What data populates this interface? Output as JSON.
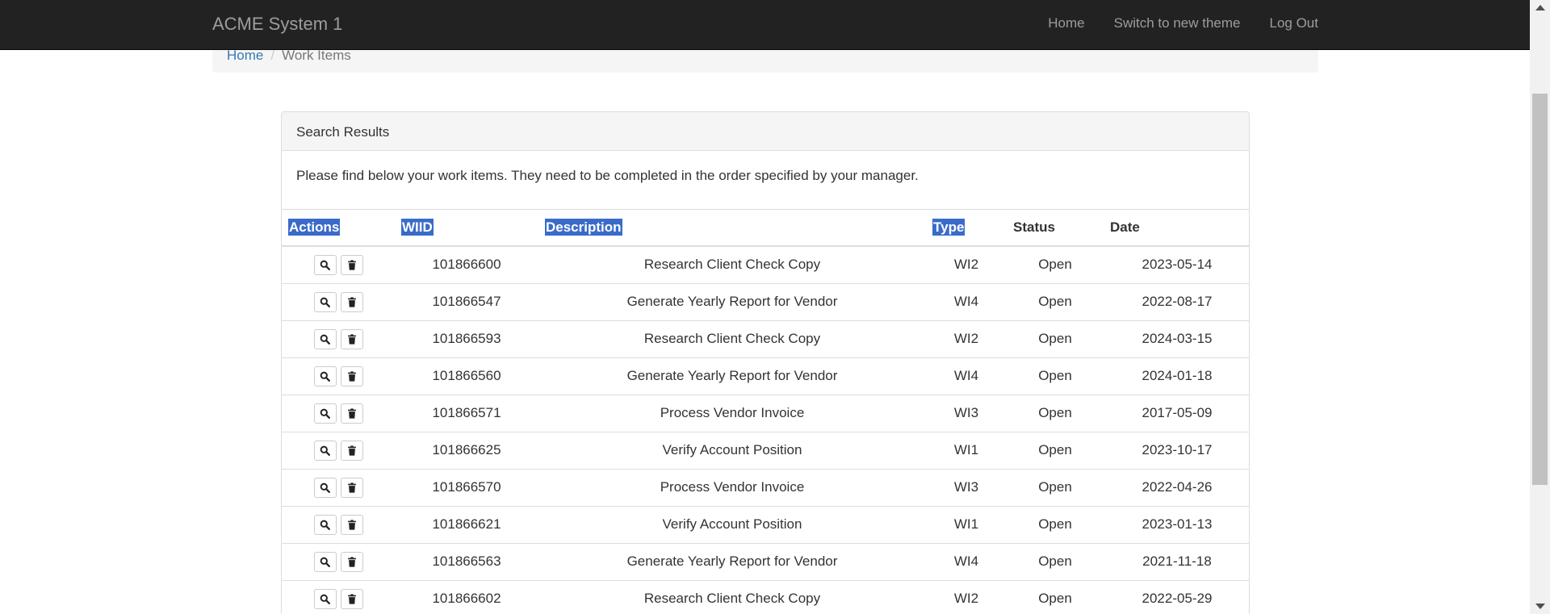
{
  "navbar": {
    "brand": "ACME System 1",
    "links": [
      "Home",
      "Switch to new theme",
      "Log Out"
    ]
  },
  "breadcrumb": {
    "home": "Home",
    "separator": "/",
    "current": "Work Items"
  },
  "panel": {
    "heading": "Search Results",
    "intro": "Please find below your work items. They need to be completed in the order specified by your manager."
  },
  "table": {
    "headers": [
      "Actions",
      "WIID",
      "Description",
      "Type",
      "Status",
      "Date"
    ],
    "rows": [
      {
        "wiid": "101866600",
        "description": "Research Client Check Copy",
        "type": "WI2",
        "status": "Open",
        "date": "2023-05-14"
      },
      {
        "wiid": "101866547",
        "description": "Generate Yearly Report for Vendor",
        "type": "WI4",
        "status": "Open",
        "date": "2022-08-17"
      },
      {
        "wiid": "101866593",
        "description": "Research Client Check Copy",
        "type": "WI2",
        "status": "Open",
        "date": "2024-03-15"
      },
      {
        "wiid": "101866560",
        "description": "Generate Yearly Report for Vendor",
        "type": "WI4",
        "status": "Open",
        "date": "2024-01-18"
      },
      {
        "wiid": "101866571",
        "description": "Process Vendor Invoice",
        "type": "WI3",
        "status": "Open",
        "date": "2017-05-09"
      },
      {
        "wiid": "101866625",
        "description": "Verify Account Position",
        "type": "WI1",
        "status": "Open",
        "date": "2023-10-17"
      },
      {
        "wiid": "101866570",
        "description": "Process Vendor Invoice",
        "type": "WI3",
        "status": "Open",
        "date": "2022-04-26"
      },
      {
        "wiid": "101866621",
        "description": "Verify Account Position",
        "type": "WI1",
        "status": "Open",
        "date": "2023-01-13"
      },
      {
        "wiid": "101866563",
        "description": "Generate Yearly Report for Vendor",
        "type": "WI4",
        "status": "Open",
        "date": "2021-11-18"
      },
      {
        "wiid": "101866602",
        "description": "Research Client Check Copy",
        "type": "WI2",
        "status": "Open",
        "date": "2022-05-29"
      }
    ]
  },
  "icons": {
    "view": "search-icon",
    "delete": "trash-icon"
  },
  "colors": {
    "navbar_bg": "#222222",
    "link": "#337ab7",
    "selection_highlight": "#3a6bc9"
  }
}
